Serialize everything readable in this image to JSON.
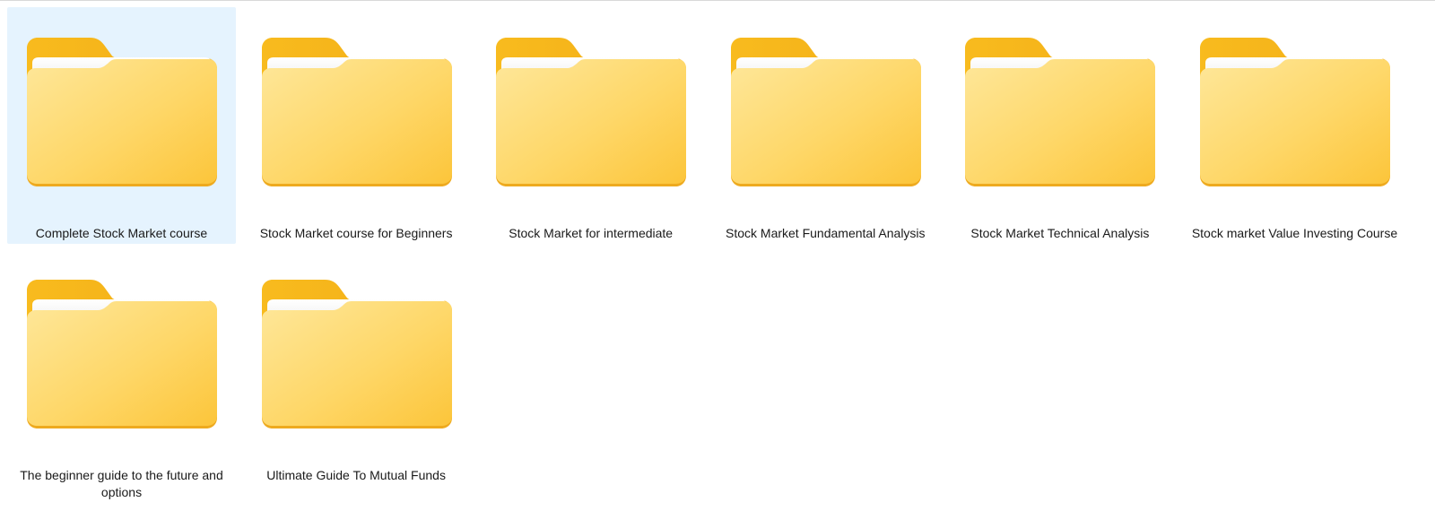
{
  "explorer": {
    "selected_index": 0,
    "items": [
      {
        "label": "Complete Stock Market course",
        "icon": "folder-icon"
      },
      {
        "label": "Stock Market course for Beginners",
        "icon": "folder-icon"
      },
      {
        "label": "Stock Market for intermediate",
        "icon": "folder-icon"
      },
      {
        "label": "Stock Market Fundamental Analysis",
        "icon": "folder-icon"
      },
      {
        "label": "Stock Market Technical Analysis",
        "icon": "folder-icon"
      },
      {
        "label": "Stock market Value Investing Course",
        "icon": "folder-icon"
      },
      {
        "label": "The beginner guide to the future and options",
        "icon": "folder-icon"
      },
      {
        "label": "Ultimate Guide To Mutual Funds",
        "icon": "folder-icon"
      }
    ]
  },
  "colors": {
    "selection": "#e5f3fe",
    "folder_back": "#f6b31a",
    "folder_front_light": "#fee79a",
    "folder_front_dark": "#fcc53a",
    "folder_paper": "#f3f3f3"
  }
}
